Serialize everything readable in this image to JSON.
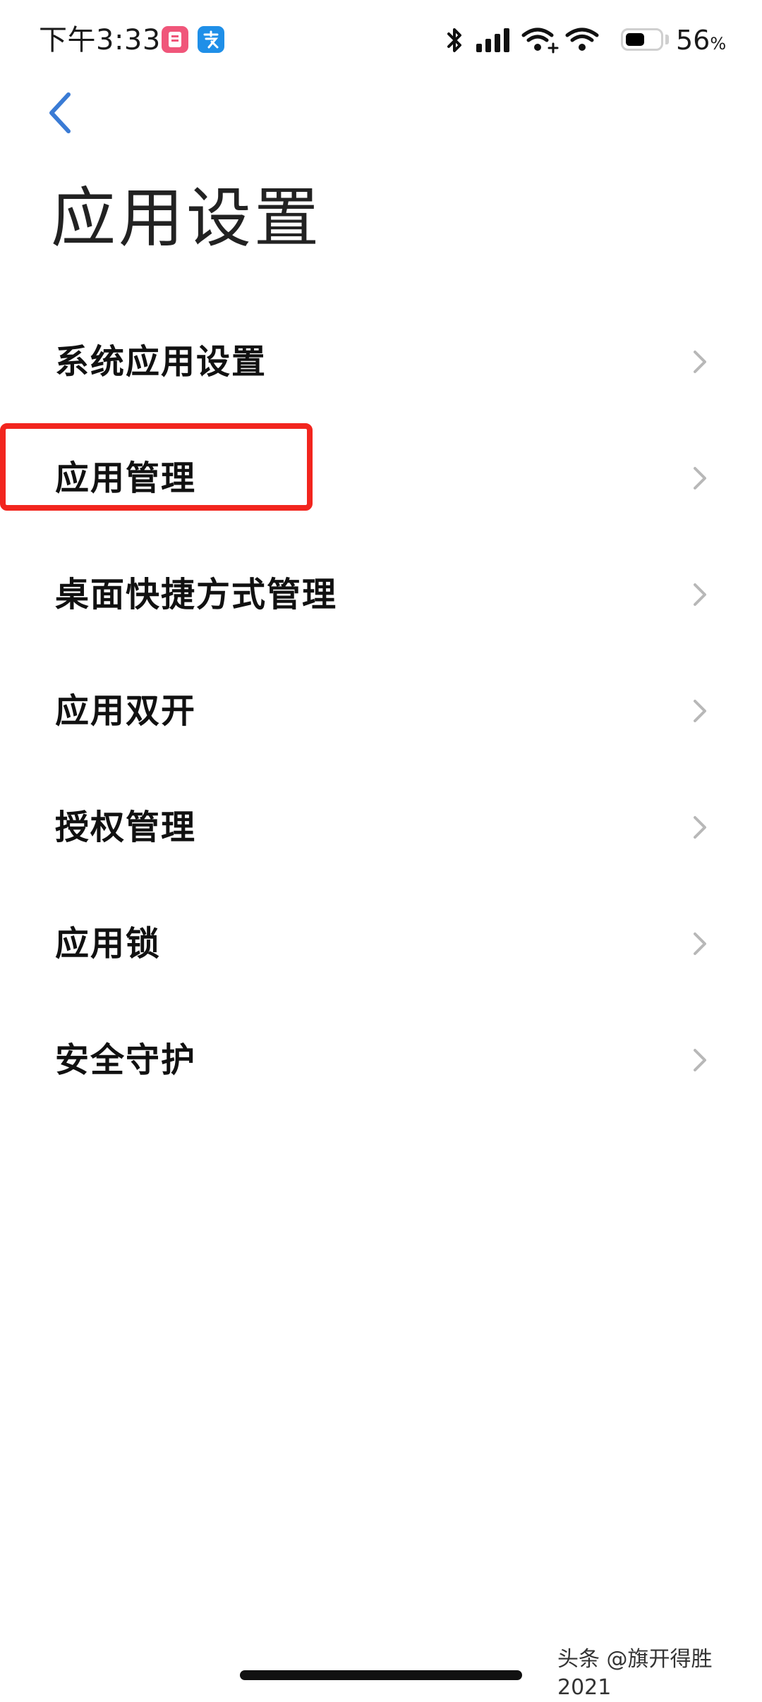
{
  "status_bar": {
    "time": "下午3:33",
    "battery_level": "56",
    "battery_unit": "%",
    "battery_fraction": 0.56,
    "notification_icons": [
      "notes-app-icon",
      "alipay-icon"
    ],
    "system_icons": [
      "bluetooth-icon",
      "cellular-signal-icon",
      "wifi-plus-icon",
      "wifi-icon",
      "battery-icon"
    ]
  },
  "header": {
    "back_icon": "chevron-left-icon",
    "title": "应用设置"
  },
  "settings_list": {
    "items": [
      {
        "label": "系统应用设置",
        "chevron": "chevron-right-icon"
      },
      {
        "label": "应用管理",
        "chevron": "chevron-right-icon",
        "highlighted": true
      },
      {
        "label": "桌面快捷方式管理",
        "chevron": "chevron-right-icon"
      },
      {
        "label": "应用双开",
        "chevron": "chevron-right-icon"
      },
      {
        "label": "授权管理",
        "chevron": "chevron-right-icon"
      },
      {
        "label": "应用锁",
        "chevron": "chevron-right-icon"
      },
      {
        "label": "安全守护",
        "chevron": "chevron-right-icon"
      }
    ]
  },
  "watermark": "头条 @旗开得胜2021",
  "colors": {
    "accent": "#3a7bd5",
    "highlight": "#f2251e",
    "text": "#111111",
    "chevron": "#b8b8b8"
  }
}
